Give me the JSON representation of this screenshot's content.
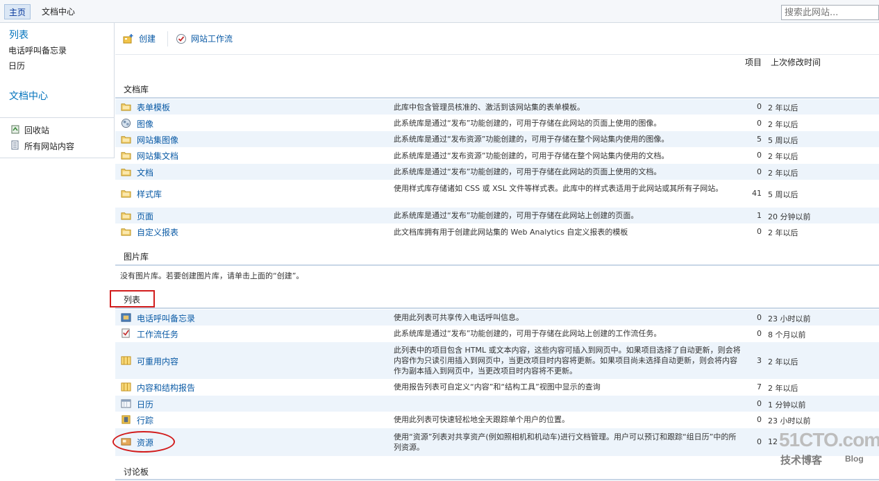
{
  "topnav": {
    "home": "主页",
    "doc_center": "文档中心",
    "search_placeholder": "搜索此网站..."
  },
  "leftnav": {
    "lists_heading": "列表",
    "list_items": [
      "电话呼叫备忘录",
      "日历"
    ],
    "doc_center_heading": "文档中心",
    "recycle_bin": "回收站",
    "all_site_content": "所有网站内容"
  },
  "toolbar": {
    "create": "创建",
    "site_workflow": "网站工作流"
  },
  "columns": {
    "items": "项目",
    "last_modified": "上次修改时间"
  },
  "sections": {
    "doc_libraries": {
      "title": "文档库",
      "rows": [
        {
          "name": "表单模板",
          "desc": "此库中包含管理员核准的、激活到该网站集的表单模板。",
          "count": "0",
          "time": "2 年以后",
          "icon": "folder-icon"
        },
        {
          "name": "图像",
          "desc": "此系统库是通过“发布”功能创建的，可用于存储在此网站的页面上使用的图像。",
          "count": "0",
          "time": "2 年以后",
          "icon": "image-icon"
        },
        {
          "name": "网站集图像",
          "desc": "此系统库是通过“发布资源”功能创建的，可用于存储在整个网站集内使用的图像。",
          "count": "5",
          "time": "5 周以后",
          "icon": "folder-icon"
        },
        {
          "name": "网站集文档",
          "desc": "此系统库是通过“发布资源”功能创建的，可用于存储在整个网站集内使用的文档。",
          "count": "0",
          "time": "2 年以后",
          "icon": "folder-icon"
        },
        {
          "name": "文档",
          "desc": "此系统库是通过“发布”功能创建的，可用于存储在此网站的页面上使用的文档。",
          "count": "0",
          "time": "2 年以后",
          "icon": "folder-icon"
        },
        {
          "name": "样式库",
          "desc": "使用样式库存储诸如 CSS 或 XSL 文件等样式表。此库中的样式表适用于此网站或其所有子网站。",
          "count": "41",
          "time": "5 周以后",
          "icon": "folder-icon"
        },
        {
          "name": "页面",
          "desc": "此系统库是通过“发布”功能创建的，可用于存储在此网站上创建的页面。",
          "count": "1",
          "time": "20 分钟以前",
          "icon": "folder-icon"
        },
        {
          "name": "自定义报表",
          "desc": "此文档库拥有用于创建此网站集的 Web Analytics 自定义报表的模板",
          "count": "0",
          "time": "2 年以后",
          "icon": "folder-icon"
        }
      ]
    },
    "picture_libraries": {
      "title": "图片库",
      "empty_note": "没有图片库。若要创建图片库，请单击上面的“创建”。"
    },
    "lists": {
      "title": "列表",
      "rows": [
        {
          "name": "电话呼叫备忘录",
          "desc": "使用此列表可共享传入电话呼叫信息。",
          "count": "0",
          "time": "23 小时以前",
          "icon": "phone-memo-icon"
        },
        {
          "name": "工作流任务",
          "desc": "此系统库是通过“发布”功能创建的，可用于存储在此网站上创建的工作流任务。",
          "count": "0",
          "time": "8 个月以前",
          "icon": "task-icon"
        },
        {
          "name": "可重用内容",
          "desc": "此列表中的项目包含 HTML 或文本内容，这些内容可插入到网页中。如果项目选择了自动更新，则会将内容作为只读引用插入到网页中，当更改项目时内容将更新。如果项目尚未选择自动更新，则会将内容作为副本插入到网页中，当更改项目时内容将不更新。",
          "count": "3",
          "time": "2 年以后",
          "icon": "list-icon"
        },
        {
          "name": "内容和结构报告",
          "desc": "使用报告列表可自定义“内容”和“结构工具”视图中显示的查询",
          "count": "7",
          "time": "2 年以后",
          "icon": "list-icon"
        },
        {
          "name": "日历",
          "desc": "",
          "count": "0",
          "time": "1 分钟以前",
          "icon": "calendar-icon"
        },
        {
          "name": "行踪",
          "desc": "使用此列表可快速轻松地全天跟踪单个用户的位置。",
          "count": "0",
          "time": "23 小时以前",
          "icon": "whereabouts-icon"
        },
        {
          "name": "资源",
          "desc": "使用“资源”列表对共享资产(例如照相机和机动车)进行文档管理。用户可以预订和跟踪“组日历”中的所列资源。",
          "count": "0",
          "time": "12",
          "icon": "resource-icon"
        }
      ]
    },
    "discussion_boards": {
      "title": "讨论板"
    }
  },
  "watermark": {
    "logo": "51CTO.com",
    "subtitle": "技术博客",
    "blog": "Blog"
  },
  "colors": {
    "link": "#0a5aa5",
    "accent_blue": "#0072bc",
    "row_alt": "#edf4fb",
    "annotation_red": "#d21c1c"
  }
}
